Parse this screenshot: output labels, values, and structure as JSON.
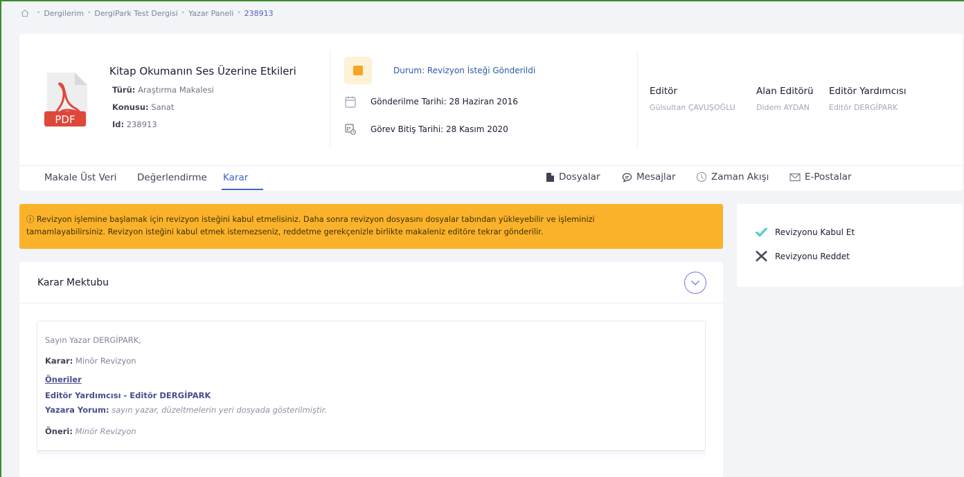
{
  "breadcrumb": {
    "items": [
      "Dergilerim",
      "DergiPark Test Dergisi",
      "Yazar Paneli"
    ],
    "current": "238913"
  },
  "article": {
    "title": "Kitap Okumanın Ses Üzerine Etkileri",
    "type_label": "Türü:",
    "type_value": "Araştırma Makalesi",
    "subject_label": "Konusu:",
    "subject_value": "Sanat",
    "id_label": "Id:",
    "id_value": "238913",
    "file_badge": "PDF"
  },
  "status": {
    "text": "Durum: Revizyon İsteği Gönderildi",
    "sent_date": "Gönderilme Tarihi: 28 Haziran 2016",
    "due_date": "Görev Bitiş Tarihi: 28 Kasım 2020"
  },
  "editors": {
    "editor_label": "Editör",
    "editor_value": "Gülsultan ÇAVUŞOĞLU",
    "area_editor_label": "Alan Editörü",
    "area_editor_value": "Didem AYDAN",
    "assistant_label": "Editör Yardımcısı",
    "assistant_value": "Editör DERGİPARK"
  },
  "tabs": [
    {
      "label": "Makale Üst Veri"
    },
    {
      "label": "Değerlendirme"
    },
    {
      "label": "Karar"
    }
  ],
  "utility_links": {
    "files": "Dosyalar",
    "messages": "Mesajlar",
    "timeline": "Zaman Akışı",
    "emails": "E-Postalar"
  },
  "alert": {
    "line1": "Revizyon işlemine başlamak için revizyon isteğini kabul etmelisiniz. Daha sonra revizyon dosyasını dosyalar tabından yükleyebilir ve işleminizi",
    "line2": "tamamlayabilirsiniz. Revizyon isteğini kabul etmek istemezseniz, reddetme gerekçenizle birlikte makaleniz editöre tekrar gönderilir."
  },
  "actions": {
    "accept": "Revizyonu Kabul Et",
    "reject": "Revizyonu Reddet"
  },
  "letter": {
    "title": "Karar Mektubu",
    "greeting": "Sayın Yazar DERGİPARK,",
    "decision_label": "Karar:",
    "decision_value": "Minör Revizyon",
    "suggestions_heading": "Öneriler",
    "reviewer": "Editör Yardımcısı - Editör DERGİPARK",
    "comment_label": "Yazara Yorum:",
    "comment_value": "sayın yazar, düzeltmelerin yeri dosyada gösterilmiştir.",
    "suggestion_label": "Öneri:",
    "suggestion_value": "Minör Revizyon"
  },
  "colors": {
    "accent": "#3f63c2",
    "alert_bg": "#fbb22b",
    "pdf_red": "#e0473b",
    "accept_check": "#3ec5c0"
  }
}
